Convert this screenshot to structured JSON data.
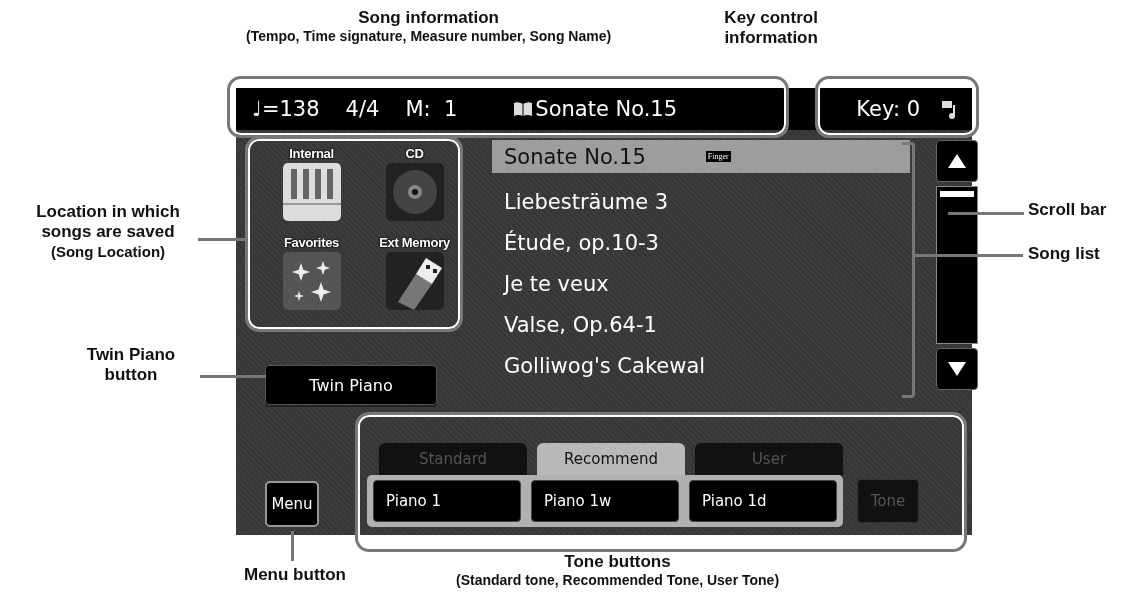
{
  "annotations": {
    "top": [
      {
        "title": "Song information",
        "subtitle": "(Tempo, Time signature, Measure number, Song Name)"
      },
      {
        "title": "Key control information"
      }
    ],
    "left": [
      {
        "title": "Location in which songs are saved",
        "subtitle": "(Song Location)"
      },
      {
        "title": "Twin Piano button"
      }
    ],
    "right": [
      {
        "title": "Scroll bar"
      },
      {
        "title": "Song list"
      }
    ],
    "bottom": [
      {
        "title": "Menu button"
      },
      {
        "title": "Tone buttons",
        "subtitle": "(Standard tone, Recommended Tone, User Tone)"
      }
    ]
  },
  "status_bar": {
    "tempo": "♩=138",
    "time_signature": "4/4",
    "measure": "M:  1",
    "song_name": "Sonate No.15",
    "key": "Key: 0"
  },
  "locations": [
    {
      "label": "Internal",
      "kind": "piano"
    },
    {
      "label": "CD",
      "kind": "disc"
    },
    {
      "label": "Favorites",
      "kind": "sparkle"
    },
    {
      "label": "Ext Memory",
      "kind": "usb"
    }
  ],
  "songs": [
    {
      "title": "Sonate No.15",
      "selected": true,
      "tag": "Finger"
    },
    {
      "title": "Liebesträume 3",
      "selected": false
    },
    {
      "title": "Étude, op.10-3",
      "selected": false
    },
    {
      "title": "Je te veux",
      "selected": false
    },
    {
      "title": "Valse, Op.64-1",
      "selected": false
    },
    {
      "title": "Golliwog's Cakewal",
      "selected": false
    }
  ],
  "twin_piano": "Twin Piano",
  "menu": "Menu",
  "tone_tabs": [
    {
      "label": "Standard",
      "selected": false
    },
    {
      "label": "Recommend",
      "selected": true
    },
    {
      "label": "User",
      "selected": false
    }
  ],
  "tone_buttons": [
    "Piano 1",
    "Piano 1w",
    "Piano 1d"
  ],
  "tone_button": {
    "label": "Tone",
    "disabled": true
  }
}
